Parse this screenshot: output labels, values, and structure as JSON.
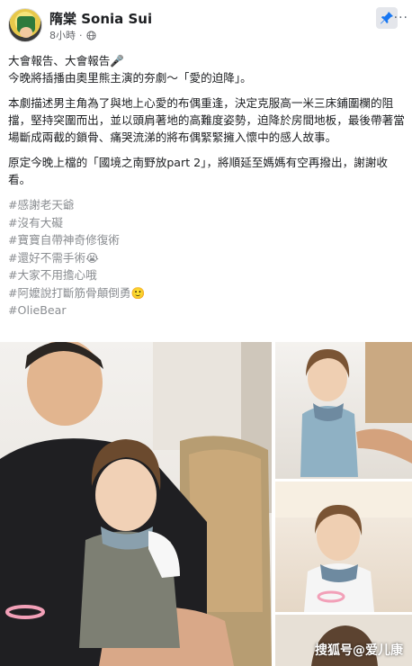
{
  "header": {
    "author": "隋棠 Sonia Sui",
    "time": "8小時",
    "separator": "·"
  },
  "post": {
    "line1": "大會報告、大會報告🎤",
    "line2": "今晚將插播由奧里熊主演的夯劇～「愛的迫降」。",
    "line3": "本劇描述男主角為了與地上心愛的布偶重逢，決定克服高一米三床鋪圍欄的阻擋，堅持突圍而出，並以頭肩著地的高難度姿勢，迫降於房間地板，最後帶著當場斷成兩截的鎖骨、痛哭流涕的將布偶緊緊擁入懷中的感人故事。",
    "line4": "原定今晚上檔的「國境之南野放part 2」，將順延至媽媽有空再撥出，謝謝收看。",
    "hashtags": [
      "#感謝老天爺",
      "#沒有大礙",
      "#寶寶自帶神奇修復術",
      "#還好不需手術😭",
      "#大家不用擔心哦",
      "#阿嬤說打斷筋骨顛倒勇🙂",
      "#OlieBear"
    ]
  },
  "watermark": "搜狐号@爱儿康",
  "icons": {
    "globe": "globe-icon",
    "pin": "pin-icon",
    "more": "more-icon"
  },
  "colors": {
    "pin_blue": "#1877f2",
    "hashtag_gray": "#8a8d91"
  }
}
